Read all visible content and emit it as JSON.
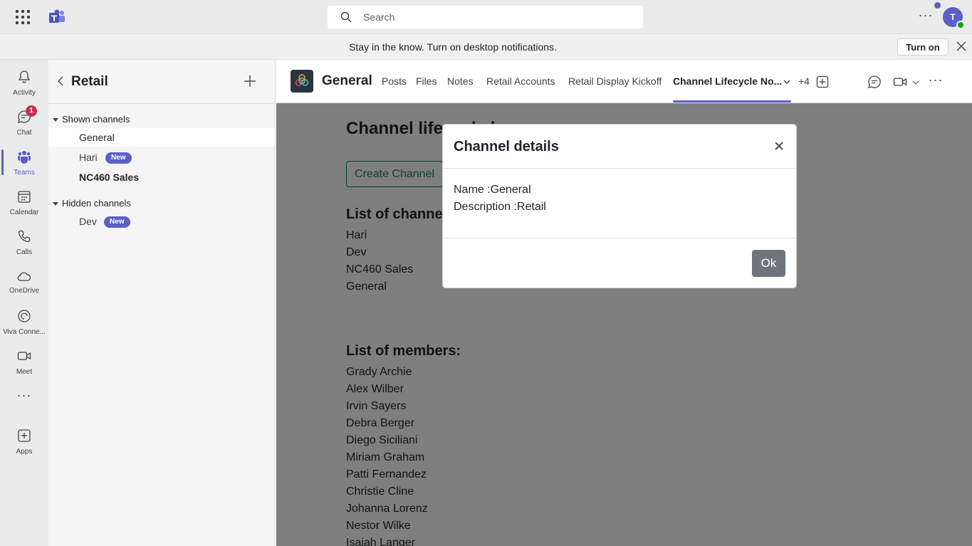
{
  "topbar": {
    "search_placeholder": "Search",
    "avatar_initial": "T"
  },
  "notification": {
    "message": "Stay in the know. Turn on desktop notifications.",
    "button_label": "Turn on"
  },
  "rail": {
    "items": [
      {
        "label": "Activity"
      },
      {
        "label": "Chat",
        "badge": "1"
      },
      {
        "label": "Teams"
      },
      {
        "label": "Calendar"
      },
      {
        "label": "Calls"
      },
      {
        "label": "OneDrive"
      },
      {
        "label": "Viva Conne..."
      },
      {
        "label": "Meet"
      },
      {
        "label": "Apps"
      }
    ]
  },
  "channel_list": {
    "team_name": "Retail",
    "shown_header": "Shown channels",
    "hidden_header": "Hidden channels",
    "shown": [
      {
        "name": "General"
      },
      {
        "name": "Hari",
        "badge": "New"
      },
      {
        "name": "NC460 Sales"
      }
    ],
    "hidden": [
      {
        "name": "Dev",
        "badge": "New"
      }
    ]
  },
  "channel_header": {
    "title": "General",
    "tabs": [
      "Posts",
      "Files",
      "Notes",
      "Retail Accounts",
      "Retail Display Kickoff",
      "Channel Lifecycle No..."
    ],
    "more_count": "+4"
  },
  "content": {
    "heading": "Channel lifecycle h",
    "create_button": "Create Channel",
    "channels_heading": "List of channels",
    "channels": [
      "Hari",
      "Dev",
      "NC460 Sales",
      "General"
    ],
    "members_heading": "List of members:",
    "members": [
      "Grady Archie",
      "Alex Wilber",
      "Irvin Sayers",
      "Debra Berger",
      "Diego Siciliani",
      "Miriam Graham",
      "Patti Fernandez",
      "Christie Cline",
      "Johanna Lorenz",
      "Nestor Wilke",
      "Isaiah Langer"
    ]
  },
  "modal": {
    "title": "Channel details",
    "name_line": "Name :General",
    "description_line": "Description :Retail",
    "ok_label": "Ok"
  },
  "colors": {
    "accent": "#5b5fc7",
    "success": "#198754",
    "secondary_button": "#6c757d",
    "badge_red": "#c4314b"
  }
}
